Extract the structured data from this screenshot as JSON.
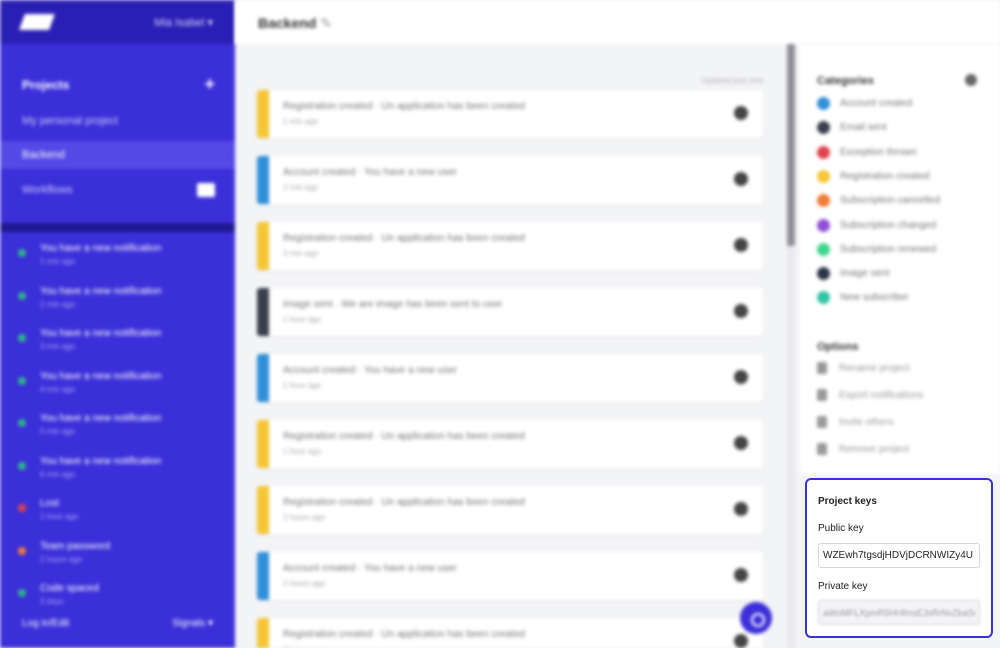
{
  "sidebar": {
    "user_menu": "Mia Isabel",
    "projects_label": "Projects",
    "add_icon": "plus-icon",
    "personal_project": "My personal project",
    "current_project": "Backend",
    "workflow": "Workflows",
    "notifications": [
      {
        "title": "You have a new notification",
        "time": "1 min ago",
        "color": "#2db38a"
      },
      {
        "title": "You have a new notification",
        "time": "2 min ago",
        "color": "#2db38a"
      },
      {
        "title": "You have a new notification",
        "time": "3 min ago",
        "color": "#2db38a"
      },
      {
        "title": "You have a new notification",
        "time": "4 min ago",
        "color": "#2db38a"
      },
      {
        "title": "You have a new notification",
        "time": "5 min ago",
        "color": "#2db38a"
      },
      {
        "title": "You have a new notification",
        "time": "6 min ago",
        "color": "#2db38a"
      },
      {
        "title": "Lost",
        "time": "1 hour ago",
        "color": "#e0424f"
      },
      {
        "title": "Team password",
        "time": "2 hours ago",
        "color": "#f07b35"
      },
      {
        "title": "Code spaced",
        "time": "3 days",
        "color": "#2db38a"
      }
    ],
    "footer_left": "Log in/Edit",
    "footer_right": "Signals"
  },
  "header": {
    "title": "Backend"
  },
  "feed": {
    "date_label": "Updated just now",
    "cards": [
      {
        "text": "Registration created · Un application has been created",
        "time": "1 min ago",
        "color": "#f5c634"
      },
      {
        "text": "Account created · You have a new user",
        "time": "2 min ago",
        "color": "#2f8fd9"
      },
      {
        "text": "Registration created · Un application has been created",
        "time": "3 min ago",
        "color": "#f5c634"
      },
      {
        "text": "Image sent · We are image has been sent to user",
        "time": "1 hour ago",
        "color": "#3a3f4b"
      },
      {
        "text": "Account created · You have a new user",
        "time": "1 hour ago",
        "color": "#2f8fd9"
      },
      {
        "text": "Registration created · Un application has been created",
        "time": "1 hour ago",
        "color": "#f5c634"
      },
      {
        "text": "Registration created · Un application has been created",
        "time": "2 hours ago",
        "color": "#f5c634"
      },
      {
        "text": "Account created · You have a new user",
        "time": "2 hours ago",
        "color": "#2f8fd9"
      },
      {
        "text": "Registration created · Un application has been created",
        "time": "3 hours ago",
        "color": "#f5c634"
      }
    ]
  },
  "right": {
    "categories_title": "Categories",
    "categories": [
      {
        "label": "Account created",
        "color": "#2f8fd9"
      },
      {
        "label": "Email sent",
        "color": "#3a3f4b"
      },
      {
        "label": "Exception thrown",
        "color": "#e0424f"
      },
      {
        "label": "Registration created",
        "color": "#f5c634"
      },
      {
        "label": "Subscription cancelled",
        "color": "#f07b35"
      },
      {
        "label": "Subscription changed",
        "color": "#8e4fd6"
      },
      {
        "label": "Subscription renewed",
        "color": "#3ed68c"
      },
      {
        "label": "Image sent",
        "color": "#2c3448"
      },
      {
        "label": "New subscriber",
        "color": "#31c4a6"
      }
    ],
    "options_title": "Options",
    "options": [
      "Rename project",
      "Export notifications",
      "Invite others",
      "Remove project"
    ]
  },
  "keys": {
    "title": "Project keys",
    "public_label": "Public key",
    "public_value": "WZEwh7tgsdjHDVjDCRNWIZy4U",
    "private_label": "Private key",
    "private_value": "aWoMFLXpmR5HHfmsEJsRrNvZkaSu"
  }
}
